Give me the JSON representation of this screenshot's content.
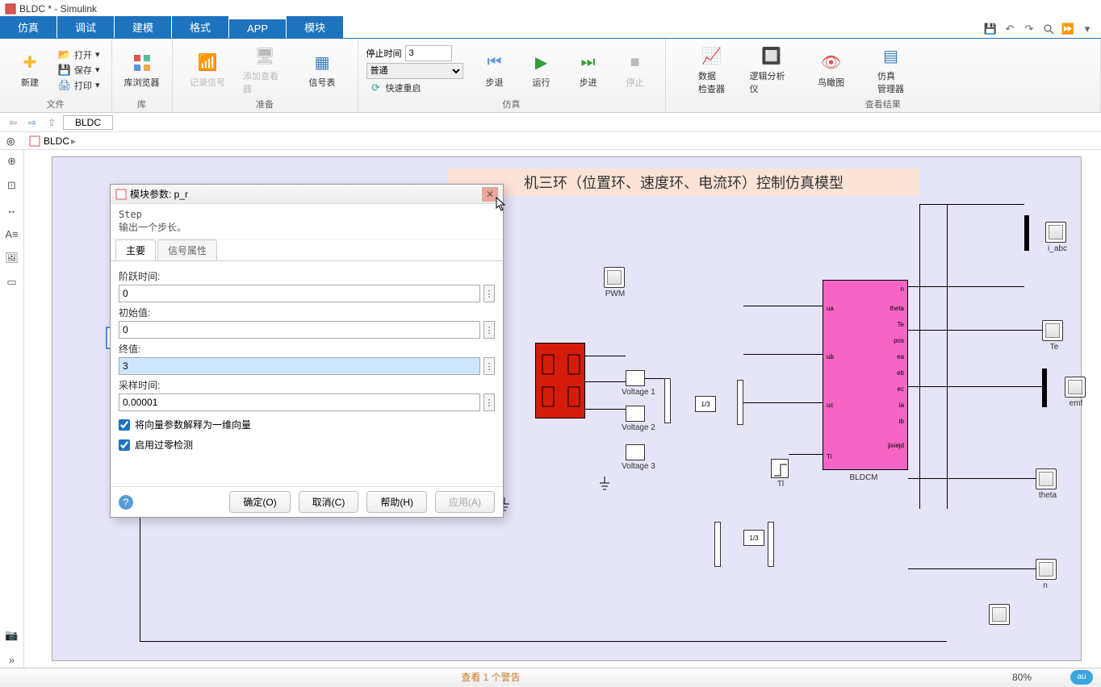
{
  "window": {
    "title": "BLDC * - Simulink"
  },
  "tabs": {
    "items": [
      "仿真",
      "调试",
      "建模",
      "格式",
      "APP",
      "模块"
    ],
    "active_index": 0
  },
  "ribbon": {
    "file": {
      "new": "新建",
      "open": "打开",
      "save": "保存",
      "print": "打印",
      "group": "文件"
    },
    "library": {
      "browser": "库浏览器",
      "group": "库"
    },
    "prepare": {
      "record": "记录信号",
      "add_viewer": "添加查看器",
      "signal_table": "信号表",
      "group": "准备"
    },
    "simulate": {
      "stop_time_label": "停止时间",
      "stop_time_value": "3",
      "mode": "普通",
      "fast_restart": "快速重启",
      "step_back": "步退",
      "run": "运行",
      "step_fwd": "步进",
      "stop": "停止",
      "group": "仿真"
    },
    "review": {
      "data_inspector": "数据\n检查器",
      "logic_analyzer": "逻辑分析仪",
      "bird_eye": "鸟瞰图",
      "sim_manager": "仿真\n管理器",
      "group": "查看结果"
    }
  },
  "nav": {
    "crumb": "BLDC",
    "bc": "BLDC"
  },
  "canvas": {
    "title": "机三环（位置环、速度环、电流环）控制仿真模型",
    "blocks": {
      "p_r": "p_r",
      "pwm": "PWM",
      "v1": "Voltage 1",
      "v2": "Voltage 2",
      "v3": "Voltage 3",
      "tl": "Tl",
      "bldcm": "BLDCM",
      "i_abc": "i_abc",
      "te": "Te",
      "emf": "emf",
      "theta": "theta",
      "n": "n",
      "gain1": "1/3",
      "gain2": "1/3",
      "ports": {
        "ua": "ua",
        "ub": "ub",
        "uc": "uc",
        "tl_in": "Tl",
        "n_out": "n",
        "theta_out": "theta",
        "te_out": "Te",
        "pos": "pos",
        "ea": "ea",
        "eb": "eb",
        "ec": "ec",
        "ia": "ia",
        "ib": "ib",
        "jixiejd": "jixiejd"
      }
    }
  },
  "dialog": {
    "title": "模块参数: p_r",
    "type_name": "Step",
    "desc": "输出一个步长。",
    "tabs": [
      "主要",
      "信号属性"
    ],
    "fields": {
      "step_time_label": "阶跃时间:",
      "step_time": "0",
      "initial_label": "初始值:",
      "initial": "0",
      "final_label": "终值:",
      "final": "3",
      "sample_label": "采样时间:",
      "sample": "0.00001"
    },
    "chk1": "将向量参数解释为一维向量",
    "chk2": "启用过零检测",
    "ok": "确定(O)",
    "cancel": "取消(C)",
    "help": "帮助(H)",
    "apply": "应用(A)"
  },
  "status": {
    "warning": "查看 1 个警告",
    "zoom": "80%",
    "au": "au"
  }
}
